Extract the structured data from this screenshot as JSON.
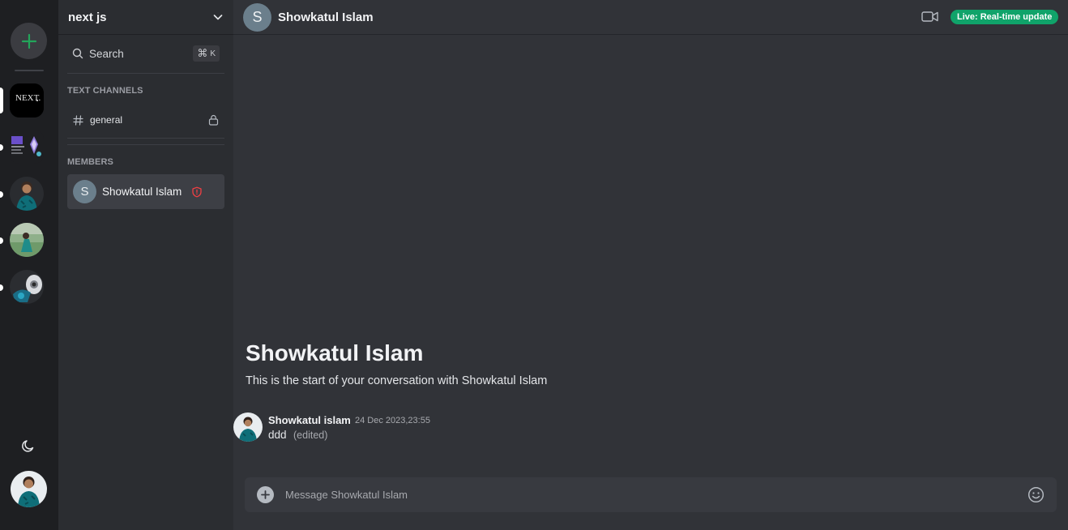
{
  "rail": {
    "icons": {
      "add": "plus-icon",
      "theme": "moon-icon"
    },
    "accent": "#23a55a",
    "servers": [
      {
        "name": "next-js-server",
        "logo_text": "NEXT.",
        "selected": true
      },
      {
        "name": "server-2"
      },
      {
        "name": "server-3"
      },
      {
        "name": "server-4"
      },
      {
        "name": "server-5"
      }
    ]
  },
  "sidebar": {
    "server_name": "next js",
    "search": {
      "label": "Search",
      "shortcut_symbol": "⌘",
      "shortcut_key": "K"
    },
    "sections": {
      "text_channels": "TEXT CHANNELS",
      "members": "MEMBERS"
    },
    "channels": [
      {
        "name": "general",
        "locked": true
      }
    ],
    "members": [
      {
        "initial": "S",
        "name": "Showkatul Islam",
        "role_icon": "shield-alert-icon",
        "role_color": "#f23f43"
      }
    ]
  },
  "chat": {
    "header": {
      "initial": "S",
      "name": "Showkatul Islam",
      "live_badge": "Live: Real-time update",
      "live_color": "#10a36a"
    },
    "welcome": {
      "title": "Showkatul Islam",
      "subtitle": "This is the start of your conversation with Showkatul Islam"
    },
    "messages": [
      {
        "author": "Showkatul islam",
        "timestamp": "24 Dec 2023,23:55",
        "text": "ddd",
        "edited_label": "(edited)"
      }
    ],
    "composer": {
      "placeholder": "Message Showkatul Islam"
    }
  }
}
